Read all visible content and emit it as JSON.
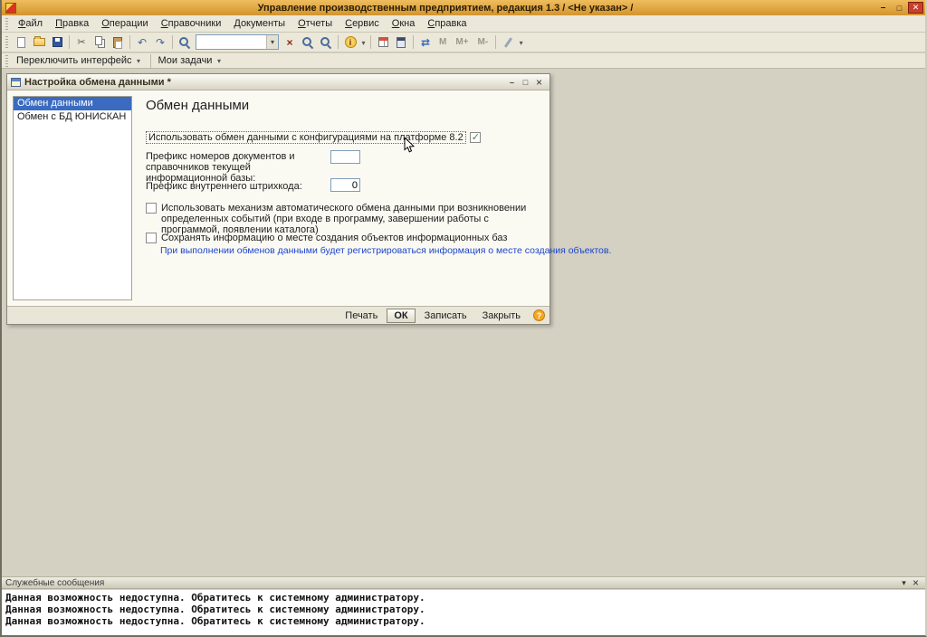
{
  "titlebar": {
    "title": "Управление производственным предприятием, редакция 1.3 / <Не указан> /"
  },
  "menu": {
    "items": [
      {
        "label": "Файл"
      },
      {
        "label": "Правка"
      },
      {
        "label": "Операции"
      },
      {
        "label": "Справочники"
      },
      {
        "label": "Документы"
      },
      {
        "label": "Отчеты"
      },
      {
        "label": "Сервис"
      },
      {
        "label": "Окна"
      },
      {
        "label": "Справка"
      }
    ]
  },
  "toolbar": {
    "search_value": "",
    "memory_buttons": [
      "M",
      "M+",
      "M-"
    ],
    "icons": [
      "new-document",
      "open-folder",
      "save",
      "cut",
      "copy",
      "paste",
      "undo",
      "redo",
      "find",
      "clear-search",
      "find-in-list",
      "find-next",
      "info-menu",
      "calendar",
      "calculator",
      "data-exchange",
      "service-menu"
    ]
  },
  "interface_bar": {
    "switch_interface": "Переключить интерфейс",
    "my_tasks": "Мои задачи"
  },
  "dialog": {
    "title": "Настройка обмена данными *",
    "sidebar": {
      "items": [
        {
          "label": "Обмен данными",
          "selected": true
        },
        {
          "label": "Обмен с БД ЮНИСКАН",
          "selected": false
        }
      ]
    },
    "heading": "Обмен данными",
    "use_exchange": {
      "label": "Использовать обмен данными с конфигурациями на платформе 8.2",
      "checked": true
    },
    "prefix_numbers": {
      "label": "Префикс номеров документов и справочников текущей информационной базы:",
      "value": ""
    },
    "barcode_prefix": {
      "label": "Префикс внутреннего штрихкода:",
      "value": "0"
    },
    "auto_exchange": {
      "label": "Использовать механизм автоматического обмена данными при возникновении определенных событий (при входе в программу, завершении работы с программой, появлении каталога)",
      "checked": false
    },
    "save_location_info": {
      "label": "Сохранять информацию о месте создания объектов информационных баз",
      "checked": false
    },
    "note": "При выполнении обменов данными будет регистрироваться информация о месте создания объектов.",
    "footer": {
      "print": "Печать",
      "ok": "ОК",
      "save": "Записать",
      "close": "Закрыть"
    }
  },
  "messages_panel": {
    "title": "Служебные сообщения",
    "lines": [
      "Данная возможность недоступна. Обратитесь к системному администратору.",
      "Данная возможность недоступна. Обратитесь к системному администратору.",
      "Данная возможность недоступна. Обратитесь к системному администратору."
    ]
  },
  "colors": {
    "titlebar": "#e2a13c",
    "selection_blue": "#3a6bc0",
    "close_button_red": "#c8402c",
    "note_text_blue": "#1b45cc"
  }
}
